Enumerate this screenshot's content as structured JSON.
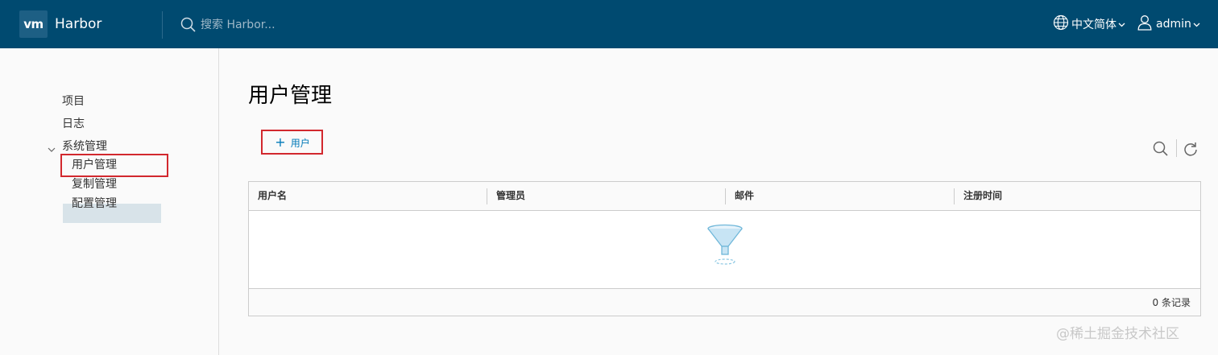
{
  "header": {
    "logo_text": "vm",
    "brand": "Harbor",
    "search_placeholder": "搜索 Harbor...",
    "language": "中文简体",
    "user": "admin",
    "bg_color": "#004a70"
  },
  "sidebar": {
    "items": [
      {
        "label": "项目"
      },
      {
        "label": "日志"
      },
      {
        "label": "系统管理",
        "expanded": true
      },
      {
        "label": "用户管理",
        "active": true
      },
      {
        "label": "复制管理"
      },
      {
        "label": "配置管理"
      }
    ]
  },
  "main": {
    "title": "用户管理",
    "add_button": "用户",
    "table": {
      "columns": [
        "用户名",
        "管理员",
        "邮件",
        "注册时间"
      ],
      "rows": [],
      "footer": "0 条记录"
    }
  },
  "watermark": "@稀土掘金技术社区",
  "colors": {
    "accent": "#0079b8",
    "highlight": "#d2282e",
    "active_bg": "#d8e3e9"
  },
  "icons": [
    "globe-icon",
    "user-icon",
    "search-icon",
    "refresh-icon",
    "filter-icon",
    "chevron-down-icon"
  ]
}
